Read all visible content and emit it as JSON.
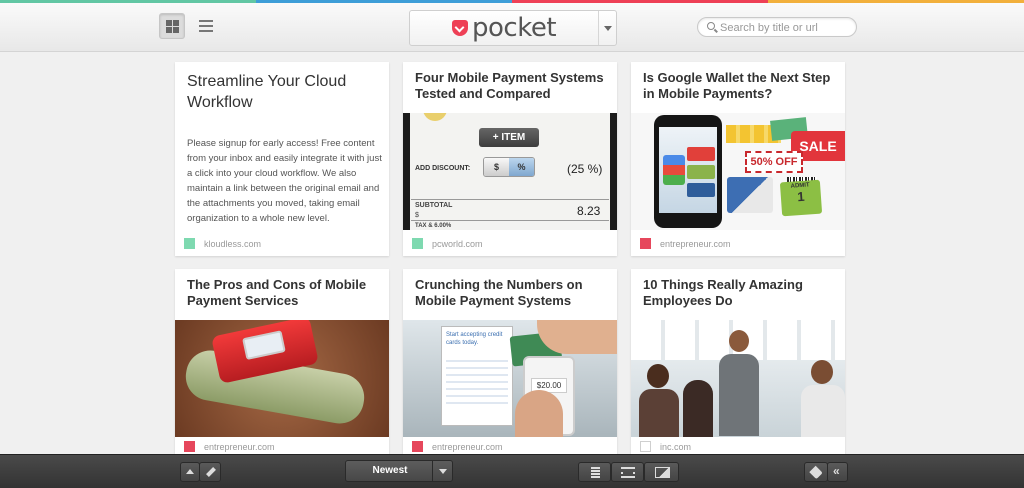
{
  "colors": {
    "stripe": [
      "#62c7a4",
      "#3e9ed8",
      "#ee4056",
      "#f2b03c"
    ],
    "brand": "#ee4056",
    "src_green": "#7ed9b0",
    "src_red": "#e6475c"
  },
  "header": {
    "logo_icon": "pocket-logo-icon",
    "logo_text": "pocket",
    "search_placeholder": "Search by title or url",
    "views": [
      "grid-view-icon",
      "list-view-icon"
    ]
  },
  "cards": [
    {
      "title": "Streamline Your Cloud Workflow",
      "excerpt": "Please signup for early access! Free content from your inbox and easily integrate it with just a click into your cloud workflow. We also maintain a link between the original email and the attachments you moved, taking email organization to a whole new level.",
      "source": "kloudless.com",
      "color": "#7ed9b0"
    },
    {
      "title": "Four Mobile Payment Systems Tested and Compared",
      "source": "pcworld.com",
      "color": "#7ed9b0",
      "thumb": {
        "button": "+ ITEM",
        "discount_label": "ADD DISCOUNT:",
        "toggle_a": "$",
        "toggle_b": "%",
        "percent": "(25 %)",
        "subtotal_label": "SUBTOTAL",
        "currency": "$",
        "subtotal_value": "8.23",
        "tax_label": "TAX & 6.00%"
      }
    },
    {
      "title": "Is Google Wallet the Next Step in Mobile Payments?",
      "source": "entrepreneur.com",
      "color": "#e6475c",
      "thumb": {
        "sale": "SALE",
        "off": "50% OFF",
        "admit": "ADMIT",
        "admit_num": "1"
      }
    },
    {
      "title": "The Pros and Cons of Mobile Payment Services",
      "source": "entrepreneur.com",
      "color": "#e6475c"
    },
    {
      "title": "Crunching the Numbers on Mobile Payment Systems",
      "source": "entrepreneur.com",
      "color": "#e6475c",
      "thumb": {
        "screen_text": "Start accepting credit cards today.",
        "amount": "$20.00"
      }
    },
    {
      "title": "10 Things Really Amazing Employees Do",
      "source": "inc.com",
      "color": "#ffffff"
    }
  ],
  "bottombar": {
    "sort_label": "Newest",
    "left_icons": [
      "up-arrow-icon",
      "edit-icon"
    ],
    "view_icons": [
      "article-view-icon",
      "video-view-icon",
      "image-view-icon"
    ],
    "right_icons": [
      "tag-icon",
      "collapse-icon"
    ]
  }
}
